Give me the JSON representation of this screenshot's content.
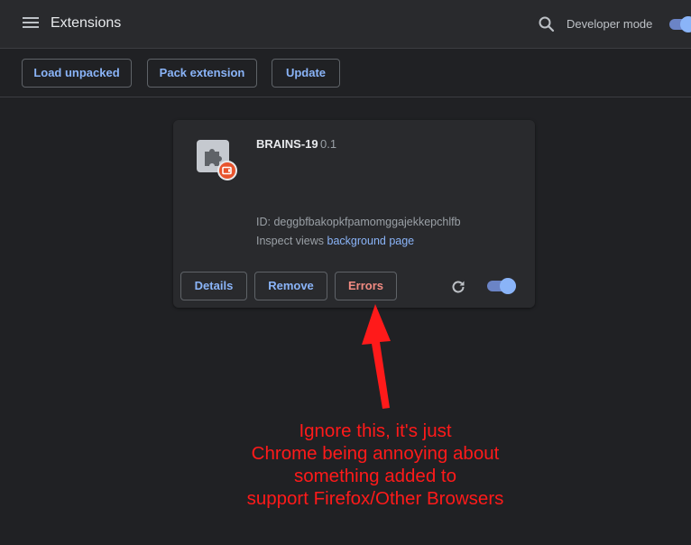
{
  "header": {
    "title": "Extensions",
    "developer_mode_label": "Developer mode",
    "developer_mode_on": true
  },
  "toolbar": {
    "load_unpacked": "Load unpacked",
    "pack_extension": "Pack extension",
    "update": "Update"
  },
  "extension": {
    "name": "BRAINS-19",
    "version": "0.1",
    "id_text": "ID: deggbfbakopkfpamomggajekkepchlfb",
    "inspect_prefix": "Inspect views",
    "inspect_link": "background page",
    "details_label": "Details",
    "remove_label": "Remove",
    "errors_label": "Errors",
    "enabled": true
  },
  "annotation": {
    "lines": [
      "Ignore this, it's just",
      "Chrome being annoying about",
      "something added to",
      "support Firefox/Other Browsers"
    ]
  },
  "colors": {
    "background": "#202124",
    "header": "#292a2d",
    "accent": "#8ab4f8",
    "error": "#f28b82",
    "annotation": "#ff1a1a"
  }
}
